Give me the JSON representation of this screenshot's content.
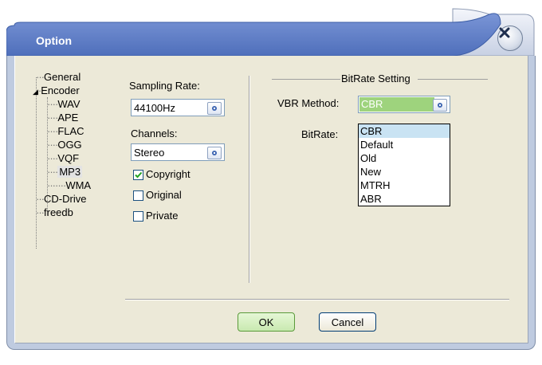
{
  "window": {
    "title": "Option",
    "accent": "#5e7cc2"
  },
  "tree": {
    "items": [
      {
        "label": "General"
      },
      {
        "label": "Encoder",
        "expanded": true
      },
      {
        "label": "WAV"
      },
      {
        "label": "APE"
      },
      {
        "label": "FLAC"
      },
      {
        "label": "OGG"
      },
      {
        "label": "VQF"
      },
      {
        "label": "MP3",
        "selected": true
      },
      {
        "label": "WMA"
      },
      {
        "label": "CD-Drive"
      },
      {
        "label": "freedb"
      }
    ]
  },
  "settings": {
    "sampling_rate_label": "Sampling Rate:",
    "sampling_rate_value": "44100Hz",
    "channels_label": "Channels:",
    "channels_value": "Stereo",
    "copyright_label": "Copyright",
    "copyright_checked": true,
    "original_label": "Original",
    "original_checked": false,
    "private_label": "Private",
    "private_checked": false
  },
  "bitrate": {
    "group_title": "BitRate Setting",
    "vbr_label": "VBR Method:",
    "vbr_value": "CBR",
    "vbr_highlight": "#9ed37d",
    "bitrate_label": "BitRate:",
    "options": [
      "CBR",
      "Default",
      "Old",
      "New",
      "MTRH",
      "ABR"
    ]
  },
  "buttons": {
    "ok": "OK",
    "cancel": "Cancel"
  }
}
